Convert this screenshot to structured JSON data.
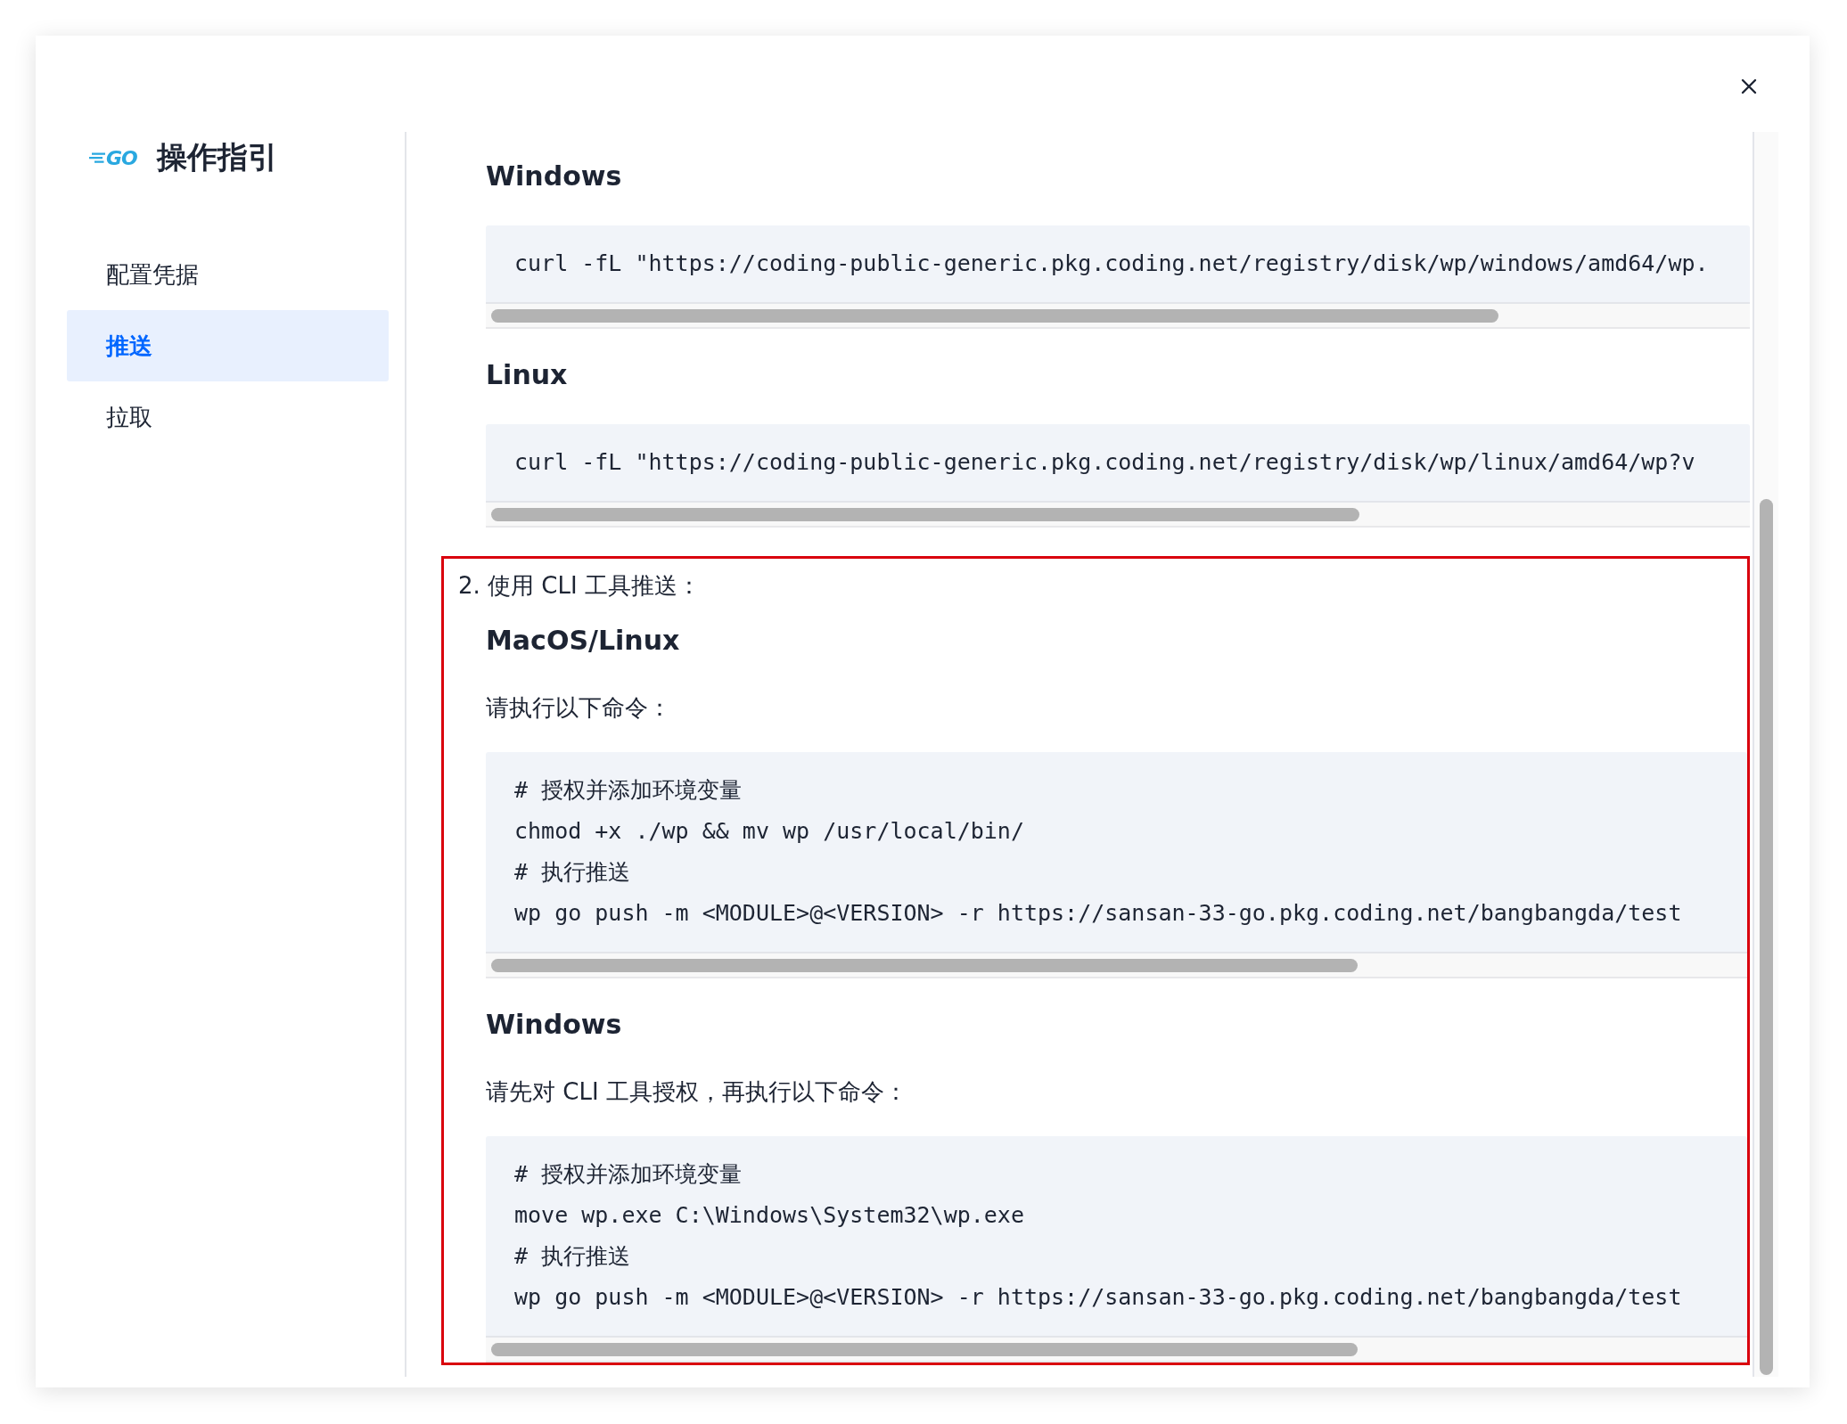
{
  "sidebar": {
    "logo": "GO",
    "title": "操作指引",
    "items": [
      {
        "label": "配置凭据",
        "selected": false
      },
      {
        "label": "推送",
        "selected": true
      },
      {
        "label": "拉取",
        "selected": false
      }
    ]
  },
  "content": {
    "blocks": [
      {
        "kind": "heading",
        "text": "Windows"
      },
      {
        "kind": "code",
        "lines": [
          "curl -fL \"https://coding-public-generic.pkg.coding.net/registry/disk/wp/windows/amd64/wp."
        ]
      },
      {
        "kind": "heading",
        "text": "Linux"
      },
      {
        "kind": "code",
        "lines": [
          "curl -fL \"https://coding-public-generic.pkg.coding.net/registry/disk/wp/linux/amd64/wp?v"
        ]
      }
    ],
    "step": {
      "number": "2.",
      "title": "使用 CLI 工具推送：",
      "highlighted": true,
      "blocks": [
        {
          "kind": "heading",
          "text": "MacOS/Linux"
        },
        {
          "kind": "paragraph",
          "text": "请执行以下命令："
        },
        {
          "kind": "code",
          "lines": [
            "# 授权并添加环境变量",
            "chmod +x ./wp && mv wp /usr/local/bin/",
            "# 执行推送",
            "wp go push -m <MODULE>@<VERSION> -r https://sansan-33-go.pkg.coding.net/bangbangda/test"
          ]
        },
        {
          "kind": "heading",
          "text": "Windows"
        },
        {
          "kind": "paragraph",
          "text": "请先对 CLI 工具授权，再执行以下命令："
        },
        {
          "kind": "code",
          "lines": [
            "# 授权并添加环境变量",
            "move wp.exe C:\\Windows\\System32\\wp.exe",
            "# 执行推送",
            "wp go push -m <MODULE>@<VERSION> -r https://sansan-33-go.pkg.coding.net/bangbangda/test"
          ]
        }
      ]
    }
  }
}
